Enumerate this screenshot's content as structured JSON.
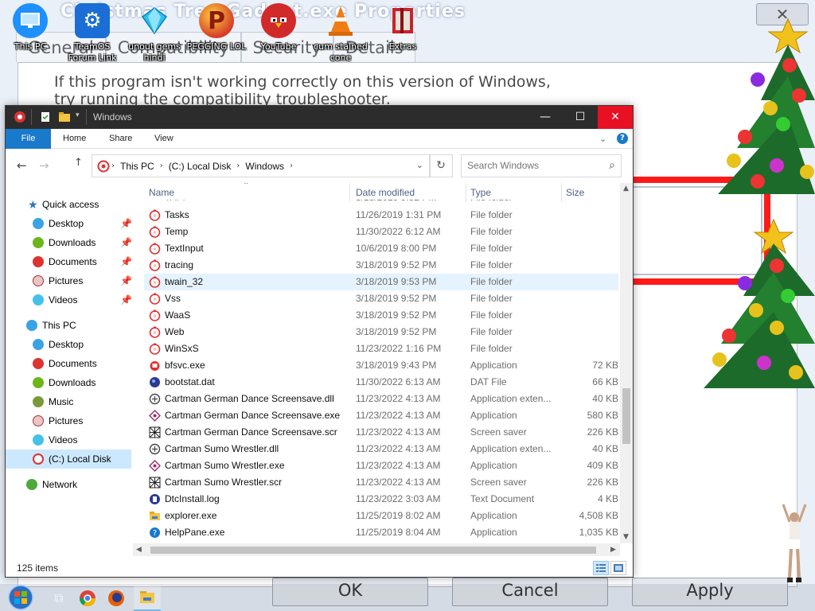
{
  "background_dialog": {
    "title": "Christmas Tree Gadget.exe Properties",
    "tabs": [
      "General",
      "Compatibility",
      "Security",
      "Details"
    ],
    "message": "If this program isn't working correctly on this version of Windows,",
    "message_2": "try running the compatibility troubleshooter.",
    "ok_label": "OK",
    "cancel_label": "Cancel",
    "apply_label": "Apply"
  },
  "desktop_icons": [
    {
      "label": "This PC",
      "icon": "monitor-icon",
      "color": "#1e90ff"
    },
    {
      "label": "TeamOS Forum Link",
      "icon": "gear-icon",
      "color": "#1b6ed6"
    },
    {
      "label": "unout gems hindi",
      "icon": "gem-icon",
      "color": "#2bc0f0"
    },
    {
      "label": "PEGGING LOL",
      "icon": "p-logo-icon",
      "color": "#d63d2a"
    },
    {
      "label": "YouTube",
      "icon": "angry-bird-icon",
      "color": "#d12a2a"
    },
    {
      "label": "cum stained cone",
      "icon": "traffic-cone-icon",
      "color": "#f07d16"
    },
    {
      "label": "Extras",
      "icon": "red-box-icon",
      "color": "#c8232b"
    }
  ],
  "window": {
    "title": "Windows",
    "ribbon_tabs": [
      "File",
      "Home",
      "Share",
      "View"
    ],
    "address": [
      "This PC",
      "(C:) Local Disk",
      "Windows"
    ],
    "search_placeholder": "Search Windows",
    "columns": [
      "Name",
      "Date modified",
      "Type",
      "Size"
    ],
    "nav": {
      "quick_access": "Quick access",
      "quick_items": [
        "Desktop",
        "Downloads",
        "Documents",
        "Pictures",
        "Videos"
      ],
      "this_pc": "This PC",
      "pc_items": [
        "Desktop",
        "Documents",
        "Downloads",
        "Music",
        "Pictures",
        "Videos",
        "(C:) Local Disk"
      ],
      "network": "Network"
    },
    "files": [
      {
        "name": "Tasks",
        "date": "11/26/2019 1:31 PM",
        "type": "File folder",
        "size": "",
        "icon": "folder-ornament-icon"
      },
      {
        "name": "Temp",
        "date": "11/30/2022 6:12 AM",
        "type": "File folder",
        "size": "",
        "icon": "folder-ornament-icon"
      },
      {
        "name": "TextInput",
        "date": "10/6/2019 8:00 PM",
        "type": "File folder",
        "size": "",
        "icon": "folder-ornament-icon"
      },
      {
        "name": "tracing",
        "date": "3/18/2019 9:52 PM",
        "type": "File folder",
        "size": "",
        "icon": "folder-ornament-icon"
      },
      {
        "name": "twain_32",
        "date": "3/18/2019 9:53 PM",
        "type": "File folder",
        "size": "",
        "icon": "folder-ornament-icon"
      },
      {
        "name": "Vss",
        "date": "3/18/2019 9:52 PM",
        "type": "File folder",
        "size": "",
        "icon": "folder-ornament-icon"
      },
      {
        "name": "WaaS",
        "date": "3/18/2019 9:52 PM",
        "type": "File folder",
        "size": "",
        "icon": "folder-ornament-icon"
      },
      {
        "name": "Web",
        "date": "3/18/2019 9:52 PM",
        "type": "File folder",
        "size": "",
        "icon": "folder-ornament-icon"
      },
      {
        "name": "WinSxS",
        "date": "11/23/2022 1:16 PM",
        "type": "File folder",
        "size": "",
        "icon": "folder-ornament-icon"
      },
      {
        "name": "bfsvc.exe",
        "date": "3/18/2019 9:43 PM",
        "type": "Application",
        "size": "72 KB",
        "icon": "app-icon"
      },
      {
        "name": "bootstat.dat",
        "date": "11/30/2022 6:13 AM",
        "type": "DAT File",
        "size": "66 KB",
        "icon": "dat-icon"
      },
      {
        "name": "Cartman German Dance Screensave.dll",
        "date": "11/23/2022 4:13 AM",
        "type": "Application exten...",
        "size": "40 KB",
        "icon": "dll-icon"
      },
      {
        "name": "Cartman German Dance Screensave.exe",
        "date": "11/23/2022 4:13 AM",
        "type": "Application",
        "size": "580 KB",
        "icon": "exe-diamond-icon"
      },
      {
        "name": "Cartman German Dance Screensave.scr",
        "date": "11/23/2022 4:13 AM",
        "type": "Screen saver",
        "size": "226 KB",
        "icon": "scr-icon"
      },
      {
        "name": "Cartman Sumo Wrestler.dll",
        "date": "11/23/2022 4:13 AM",
        "type": "Application exten...",
        "size": "40 KB",
        "icon": "dll-icon"
      },
      {
        "name": "Cartman Sumo Wrestler.exe",
        "date": "11/23/2022 4:13 AM",
        "type": "Application",
        "size": "409 KB",
        "icon": "exe-diamond-icon"
      },
      {
        "name": "Cartman Sumo Wrestler.scr",
        "date": "11/23/2022 4:13 AM",
        "type": "Screen saver",
        "size": "226 KB",
        "icon": "scr-icon"
      },
      {
        "name": "DtcInstall.log",
        "date": "11/23/2022 3:03 AM",
        "type": "Text Document",
        "size": "4 KB",
        "icon": "log-icon"
      },
      {
        "name": "explorer.exe",
        "date": "11/25/2019 8:02 AM",
        "type": "Application",
        "size": "4,508 KB",
        "icon": "explorer-icon"
      },
      {
        "name": "HelpPane.exe",
        "date": "11/25/2019 8:04 AM",
        "type": "Application",
        "size": "1,035 KB",
        "icon": "help-icon"
      }
    ],
    "status": "125 items"
  },
  "colors": {
    "accent": "#1979ca",
    "close": "#e81123",
    "titlebar": "#2c2c2c",
    "selection": "#cce8ff",
    "hover": "#e5f3ff"
  }
}
